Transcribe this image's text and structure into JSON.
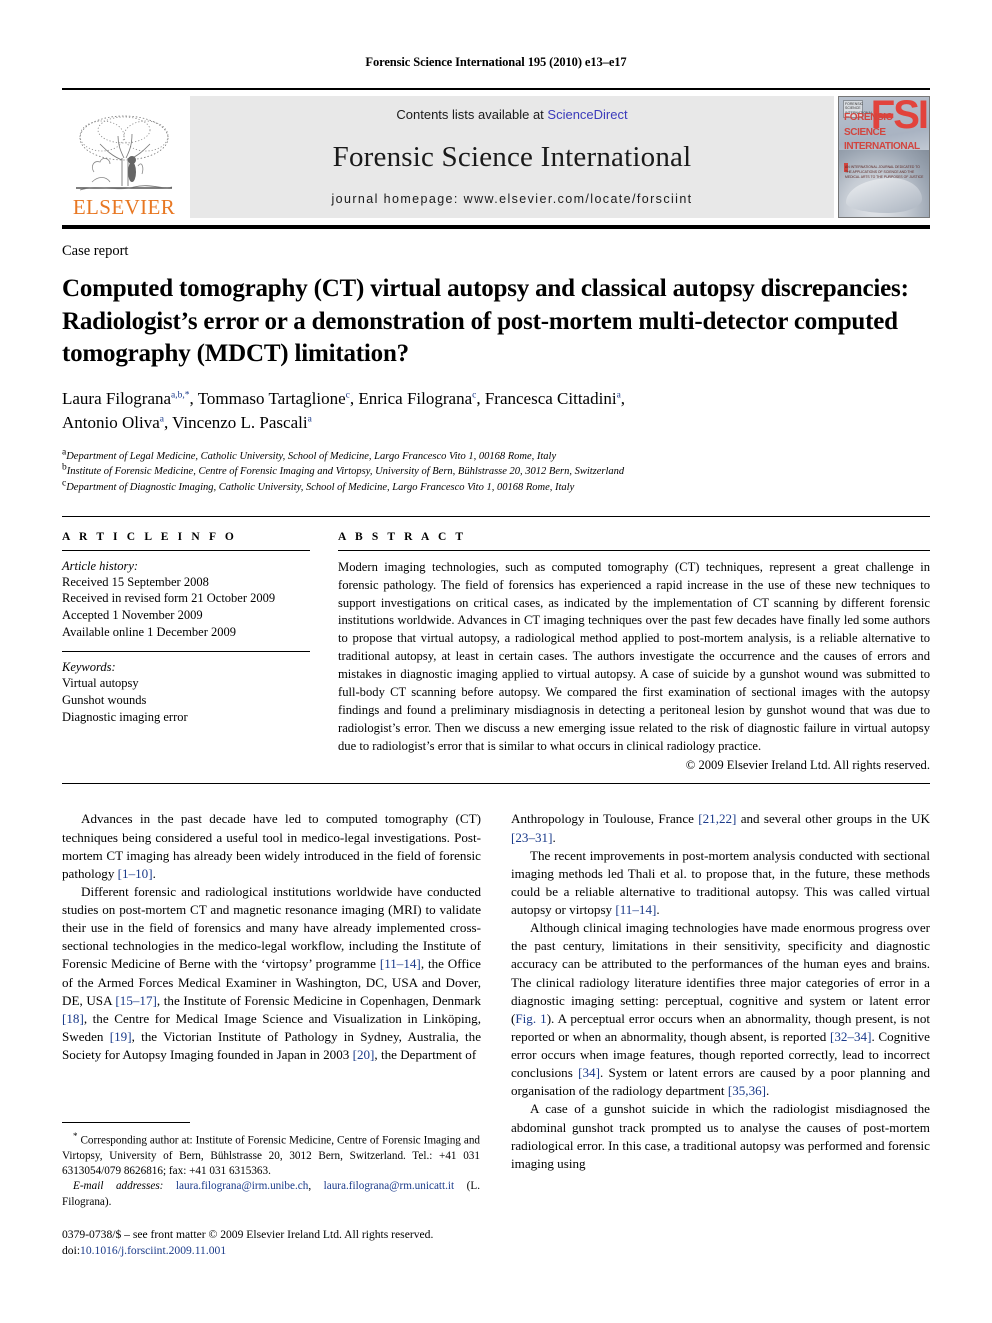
{
  "header": {
    "running_head": "Forensic Science International 195 (2010) e13–e17",
    "contents_prefix": "Contents lists available at ",
    "sciencedirect": "ScienceDirect",
    "journal_title": "Forensic Science International",
    "homepage": "journal homepage: www.elsevier.com/locate/forsciint",
    "publisher_wordmark": "ELSEVIER",
    "cover_line1": "FORENSIC",
    "cover_line2": "SCIENCE",
    "cover_line3": "INTERNATIONAL",
    "cover_initials": "FSI",
    "cover_corner": "FORENSIC SCIENCE INTERNATIONAL",
    "cover_subtitle": "AN INTERNATIONAL JOURNAL DEDICATED TO THE APPLICATIONS OF SCIENCE AND THE MEDICAL ARTS TO THE PURPOSES OF JUSTICE",
    "accent_color": "#E87722",
    "link_color": "#3b3bbb",
    "ref_color": "#1a3a8a"
  },
  "article": {
    "doctype": "Case report",
    "title": "Computed tomography (CT) virtual autopsy and classical autopsy discrepancies: Radiologist’s error or a demonstration of post-mortem multi-detector computed tomography (MDCT) limitation?",
    "authors": [
      {
        "name": "Laura Filograna",
        "marks": "a,b,*",
        "sep": ", "
      },
      {
        "name": "Tommaso Tartaglione",
        "marks": "c",
        "sep": ", "
      },
      {
        "name": "Enrica Filograna",
        "marks": "c",
        "sep": ", "
      },
      {
        "name": "Francesca Cittadini",
        "marks": "a",
        "sep": ","
      },
      {
        "name": "Antonio Oliva",
        "marks": "a",
        "sep": ", "
      },
      {
        "name": "Vincenzo L. Pascali",
        "marks": "a",
        "sep": ""
      }
    ],
    "affiliations": [
      {
        "mark": "a",
        "text": "Department of Legal Medicine, Catholic University, School of Medicine, Largo Francesco Vito 1, 00168 Rome, Italy"
      },
      {
        "mark": "b",
        "text": "Institute of Forensic Medicine, Centre of Forensic Imaging and Virtopsy, University of Bern, Bühlstrasse 20, 3012 Bern, Switzerland"
      },
      {
        "mark": "c",
        "text": "Department of Diagnostic Imaging, Catholic University, School of Medicine, Largo Francesco Vito 1, 00168 Rome, Italy"
      }
    ]
  },
  "article_info": {
    "heading": "A R T I C L E    I N F O",
    "history_label": "Article history:",
    "history": [
      "Received 15 September 2008",
      "Received in revised form 21 October 2009",
      "Accepted 1 November 2009",
      "Available online 1 December 2009"
    ],
    "keywords_label": "Keywords:",
    "keywords": [
      "Virtual autopsy",
      "Gunshot wounds",
      "Diagnostic imaging error"
    ]
  },
  "abstract": {
    "heading": "A B S T R A C T",
    "text": "Modern imaging technologies, such as computed tomography (CT) techniques, represent a great challenge in forensic pathology. The field of forensics has experienced a rapid increase in the use of these new techniques to support investigations on critical cases, as indicated by the implementation of CT scanning by different forensic institutions worldwide. Advances in CT imaging techniques over the past few decades have finally led some authors to propose that virtual autopsy, a radiological method applied to post-mortem analysis, is a reliable alternative to traditional autopsy, at least in certain cases. The authors investigate the occurrence and the causes of errors and mistakes in diagnostic imaging applied to virtual autopsy. A case of suicide by a gunshot wound was submitted to full-body CT scanning before autopsy. We compared the first examination of sectional images with the autopsy findings and found a preliminary misdiagnosis in detecting a peritoneal lesion by gunshot wound that was due to radiologist’s error. Then we discuss a new emerging issue related to the risk of diagnostic failure in virtual autopsy due to radiologist’s error that is similar to what occurs in clinical radiology practice.",
    "copyright": "© 2009 Elsevier Ireland Ltd. All rights reserved."
  },
  "body": {
    "left_column": [
      {
        "segments": [
          {
            "t": "Advances in the past decade have led to computed tomography (CT) techniques being considered a useful tool in medico-legal investigations. Post-mortem CT imaging has already been widely introduced in the field of forensic pathology "
          },
          {
            "t": "[1–10]",
            "ref": true
          },
          {
            "t": "."
          }
        ]
      },
      {
        "segments": [
          {
            "t": "Different forensic and radiological institutions worldwide have conducted studies on post-mortem CT and magnetic resonance imaging (MRI) to validate their use in the field of forensics and many have already implemented cross-sectional technologies in the medico-legal workflow, including the Institute of Forensic Medicine of Berne with the ‘virtopsy’ programme "
          },
          {
            "t": "[11–14]",
            "ref": true
          },
          {
            "t": ", the Office of the Armed Forces Medical Examiner in Washington, DC, USA and Dover, DE, USA "
          },
          {
            "t": "[15–17]",
            "ref": true
          },
          {
            "t": ", the Institute of Forensic Medicine in Copenhagen, Denmark "
          },
          {
            "t": "[18]",
            "ref": true
          },
          {
            "t": ", the Centre for Medical Image Science and Visualization in Linköping, Sweden "
          },
          {
            "t": "[19]",
            "ref": true
          },
          {
            "t": ", the Victorian Institute of Pathology in Sydney, Australia, the Society for Autopsy Imaging founded in Japan in 2003 "
          },
          {
            "t": "[20]",
            "ref": true
          },
          {
            "t": ", the Department of"
          }
        ]
      }
    ],
    "right_column": [
      {
        "noindent": true,
        "segments": [
          {
            "t": "Anthropology in Toulouse, France "
          },
          {
            "t": "[21,22]",
            "ref": true
          },
          {
            "t": " and several other groups in the UK "
          },
          {
            "t": "[23–31]",
            "ref": true
          },
          {
            "t": "."
          }
        ]
      },
      {
        "segments": [
          {
            "t": "The recent improvements in post-mortem analysis conducted with sectional imaging methods led Thali et al. to propose that, in the future, these methods could be a reliable alternative to traditional autopsy. This was called virtual autopsy or virtopsy "
          },
          {
            "t": "[11–14]",
            "ref": true
          },
          {
            "t": "."
          }
        ]
      },
      {
        "segments": [
          {
            "t": "Although clinical imaging technologies have made enormous progress over the past century, limitations in their sensitivity, specificity and diagnostic accuracy can be attributed to the performances of the human eyes and brains. The clinical radiology literature identifies three major categories of error in a diagnostic imaging setting: perceptual, cognitive and system or latent error ("
          },
          {
            "t": "Fig. 1",
            "ref": true
          },
          {
            "t": "). A perceptual error occurs when an abnormality, though present, is not reported or when an abnormality, though absent, is reported "
          },
          {
            "t": "[32–34]",
            "ref": true
          },
          {
            "t": ". Cognitive error occurs when image features, though reported correctly, lead to incorrect conclusions "
          },
          {
            "t": "[34]",
            "ref": true
          },
          {
            "t": ". System or latent errors are caused by a poor planning and organisation of the radiology department "
          },
          {
            "t": "[35,36]",
            "ref": true
          },
          {
            "t": "."
          }
        ]
      },
      {
        "segments": [
          {
            "t": "A case of a gunshot suicide in which the radiologist misdiagnosed the abdominal gunshot track prompted us to analyse the causes of post-mortem radiological error. In this case, a traditional autopsy was performed and forensic imaging using"
          }
        ]
      }
    ]
  },
  "footnote": {
    "corresponding_star": "*",
    "corresponding": "Corresponding author at: Institute of Forensic Medicine, Centre of Forensic Imaging and Virtopsy, University of Bern, Bühlstrasse 20, 3012 Bern, Switzerland. Tel.: +41 031 6313054/079 8626816; fax: +41 031 6315363.",
    "email_label": "E-mail addresses:",
    "email_1": "laura.filograna@irm.unibe.ch",
    "email_2": "laura.filograna@rm.unicatt.it",
    "email_attrib": "(L. Filograna).",
    "imprint_line": "0379-0738/$ – see front matter © 2009 Elsevier Ireland Ltd. All rights reserved.",
    "doi_label": "doi:",
    "doi_value": "10.1016/j.forsciint.2009.11.001"
  }
}
